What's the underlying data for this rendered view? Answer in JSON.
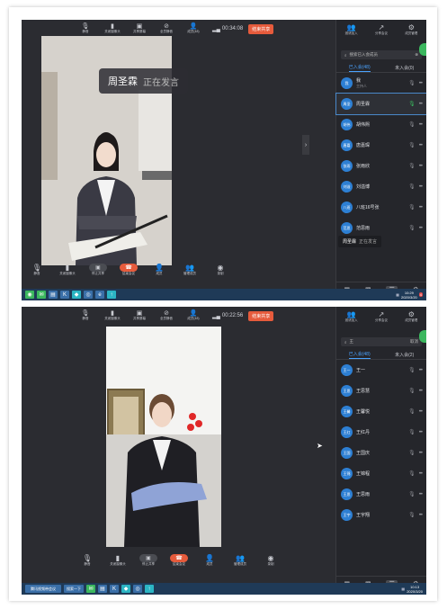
{
  "top_toolbar": {
    "items": [
      {
        "icon": "mic-icon",
        "label": "静音"
      },
      {
        "icon": "camera-icon",
        "label": "关闭摄像头"
      },
      {
        "icon": "share-icon",
        "label": "共享屏幕"
      },
      {
        "icon": "mute-all-icon",
        "label": "全员静音"
      },
      {
        "icon": "members-icon",
        "label": "成员(48)"
      }
    ],
    "timer_1": "00:34:08",
    "timer_2": "00:22:56",
    "end_share": "结束共享"
  },
  "speaker_banner": {
    "name": "周圣霖",
    "status": "正在发言"
  },
  "panel": {
    "actions": [
      {
        "icon": "invite-icon",
        "label": "邀请加入"
      },
      {
        "icon": "share-meeting-icon",
        "label": "分享会议"
      },
      {
        "icon": "manage-icon",
        "label": "成员管理"
      }
    ],
    "search_placeholder": "搜索已入会成员",
    "search_value": "王",
    "cancel": "取消",
    "tabs": {
      "joined": "已入会(48)",
      "not_joined": "未入会(0)",
      "not_joined_2": "未入会(2)"
    },
    "members_1": [
      {
        "avatar": "我",
        "name": "我",
        "role": "主持人"
      },
      {
        "avatar": "周圣",
        "name": "周圣霖"
      },
      {
        "avatar": "胡伟",
        "name": "胡伟熙"
      },
      {
        "avatar": "唐嘉",
        "name": "唐嘉琛"
      },
      {
        "avatar": "张雨",
        "name": "张雨欣"
      },
      {
        "avatar": "刘溢",
        "name": "刘溢博"
      },
      {
        "avatar": "八班",
        "name": "八班16号张"
      },
      {
        "avatar": "范思",
        "name": "范思雨"
      }
    ],
    "members_2": [
      {
        "avatar": "王一",
        "name": "王一"
      },
      {
        "avatar": "王思",
        "name": "王思慧"
      },
      {
        "avatar": "王馨",
        "name": "王馨悦"
      },
      {
        "avatar": "王红",
        "name": "王红丹"
      },
      {
        "avatar": "王国",
        "name": "王国庆"
      },
      {
        "avatar": "王锦",
        "name": "王锦程"
      },
      {
        "avatar": "王思",
        "name": "王思雨"
      },
      {
        "avatar": "王宇",
        "name": "王宇翔"
      }
    ],
    "hover_tip": {
      "name": "周圣霖",
      "status": "正在发言"
    },
    "bottom": [
      {
        "icon": "grid-icon",
        "label": "布局"
      },
      {
        "icon": "apps-icon",
        "label": "应用"
      },
      {
        "icon": "list-icon",
        "label": "成员"
      },
      {
        "icon": "settings-icon",
        "label": "设置"
      }
    ]
  },
  "bottom_toolbar": {
    "items": [
      {
        "icon": "mic-icon",
        "label": "静音"
      },
      {
        "icon": "camera-icon",
        "label": "关闭摄像头"
      },
      {
        "icon": "share-icon",
        "label": "停止共享"
      },
      {
        "icon": "end-icon",
        "label": "结束会议"
      },
      {
        "icon": "member-icon",
        "label": "成员"
      },
      {
        "icon": "manage-icon",
        "label": "管理成员"
      },
      {
        "icon": "record-icon",
        "label": "录制"
      }
    ]
  },
  "taskbar": {
    "app_label": "腾讯视频带会议",
    "search_label": "搜索一下",
    "clock_1": "10:29",
    "date_1": "2020/3/20",
    "clock_2": "10:13",
    "date_2": "2020/3/20",
    "badge": "4"
  }
}
